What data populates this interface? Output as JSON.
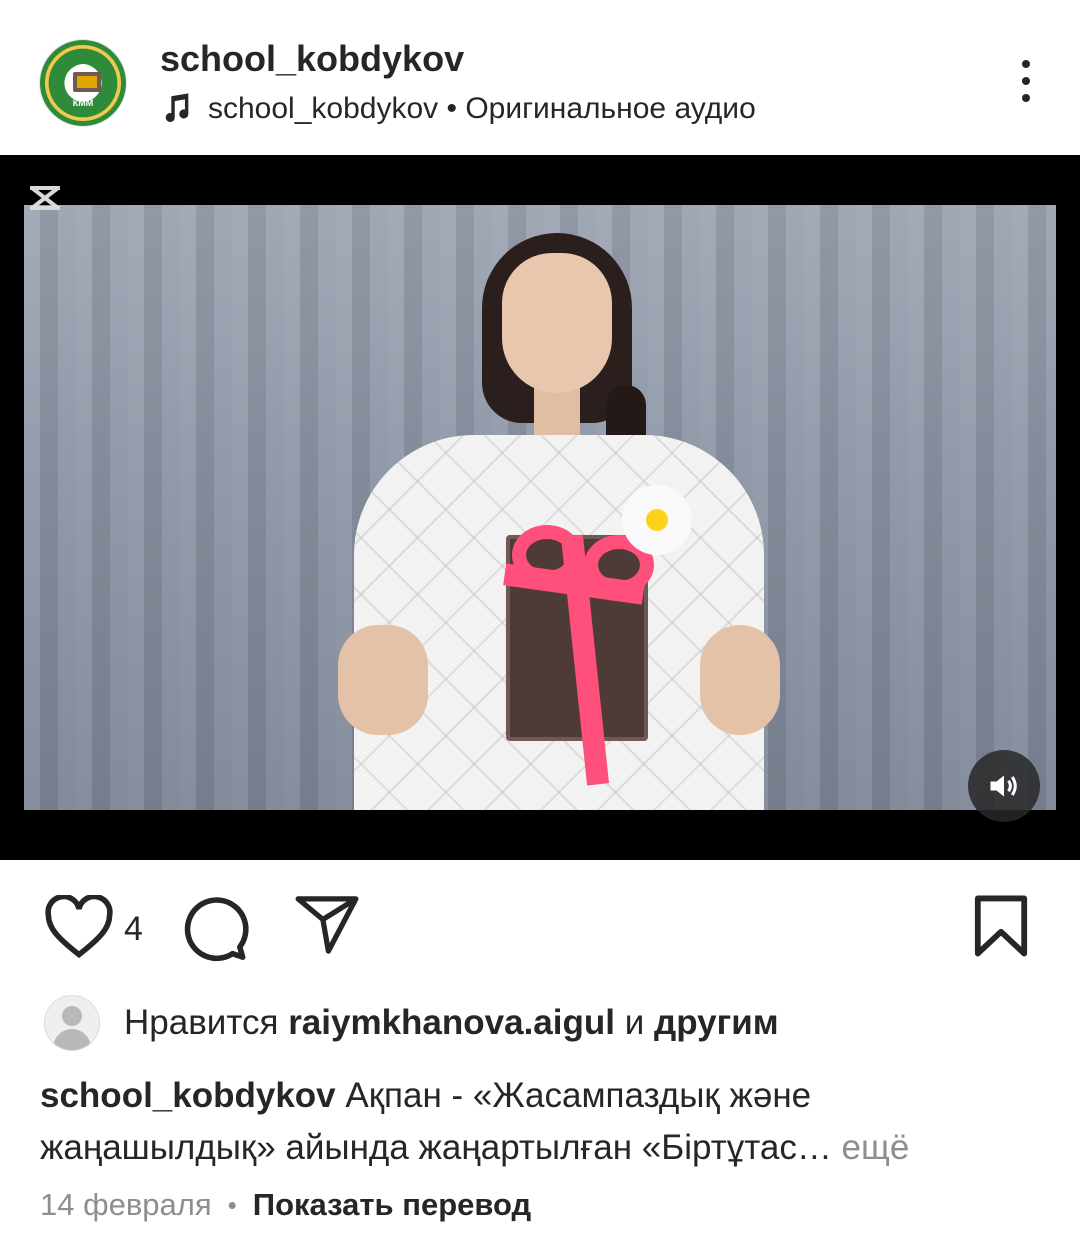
{
  "header": {
    "username": "school_kobdykov",
    "audio_text": "school_kobdykov • Оригинальное аудио",
    "avatar_text": "КММ"
  },
  "post": {
    "likes_count": "4"
  },
  "likes": {
    "prefix": "Нравится ",
    "user": "raiymkhanova.aigul",
    "middle": " и ",
    "others": "другим"
  },
  "caption": {
    "username": "school_kobdykov",
    "text": " Ақпан - «Жасампаздық және жаңашылдық» айында жаңартылған «Біртұтас…",
    "more": " ещё"
  },
  "meta": {
    "date": "14 февраля",
    "separator": "•",
    "translate": "Показать перевод"
  }
}
